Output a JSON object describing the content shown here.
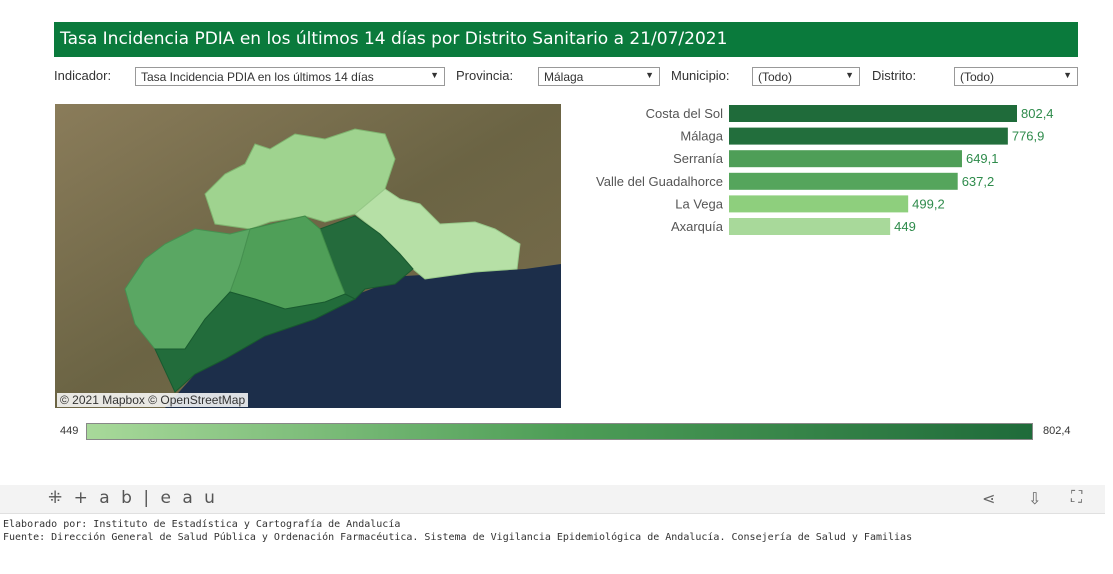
{
  "title": "Tasa Incidencia PDIA en los últimos 14 días por Distrito Sanitario a 21/07/2021",
  "filters": {
    "indicador_label": "Indicador:",
    "indicador_value": "Tasa Incidencia PDIA en los últimos 14 días",
    "provincia_label": "Provincia:",
    "provincia_value": "Málaga",
    "municipio_label": "Municipio:",
    "municipio_value": "(Todo)",
    "distrito_label": "Distrito:",
    "distrito_value": "(Todo)"
  },
  "map": {
    "attribution": "© 2021 Mapbox  © OpenStreetMap"
  },
  "chart_data": {
    "type": "bar",
    "orientation": "horizontal",
    "categories": [
      "Costa del Sol",
      "Málaga",
      "Serranía",
      "Valle del Guadalhorce",
      "La Vega",
      "Axarquía"
    ],
    "values": [
      802.4,
      776.9,
      649.1,
      637.2,
      499.2,
      449
    ],
    "value_labels": [
      "802,4",
      "776,9",
      "649,1",
      "637,2",
      "499,2",
      "449"
    ],
    "colors": [
      "#1f6b3a",
      "#226e3c",
      "#4e9e57",
      "#55a55c",
      "#8ecf7d",
      "#a8d99a"
    ],
    "label_color": "#2e8b4b"
  },
  "legend": {
    "min_label": "449",
    "max_label": "802,4"
  },
  "toolbar": {
    "logo": "+ a b | e a u",
    "share_icon": "share-icon",
    "download_icon": "download-icon",
    "fullscreen_icon": "fullscreen-icon"
  },
  "footer": {
    "line1": "Elaborado por: Instituto de Estadística y Cartografía de Andalucía",
    "line2": "Fuente: Dirección General de Salud Pública y Ordenación Farmacéutica. Sistema de Vigilancia Epidemiológica de Andalucía. Consejería de Salud y Familias"
  }
}
